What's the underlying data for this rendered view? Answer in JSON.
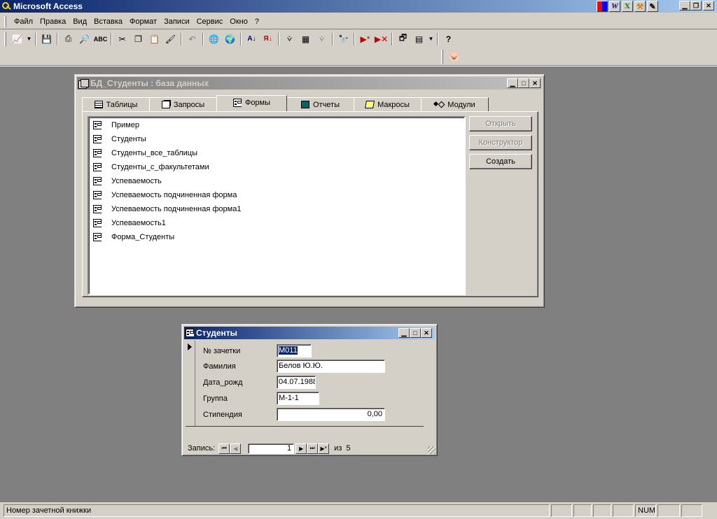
{
  "app": {
    "title": "Microsoft Access"
  },
  "office_icons": [
    "W",
    "X",
    "",
    ""
  ],
  "menu": [
    "Файл",
    "Правка",
    "Вид",
    "Вставка",
    "Формат",
    "Записи",
    "Сервис",
    "Окно",
    "?"
  ],
  "db_window": {
    "title": "БД_Студенты : база данных",
    "tabs": [
      "Таблицы",
      "Запросы",
      "Формы",
      "Отчеты",
      "Макросы",
      "Модули"
    ],
    "selected_tab": "Формы",
    "items": [
      "Пример",
      "Студенты",
      "Студенты_все_таблицы",
      "Студенты_с_факультетами",
      "Успеваемость",
      "Успеваемость подчиненная форма",
      "Успеваемость подчиненная форма1",
      "Успеваемость1",
      "Форма_Студенты"
    ],
    "buttons": {
      "open": "Открыть",
      "design": "Конструктор",
      "create": "Создать"
    }
  },
  "form_window": {
    "title": "Студенты",
    "fields": {
      "record_book_label": "№ зачетки",
      "record_book_value": "М011",
      "surname_label": "Фамилия",
      "surname_value": "Белов Ю.Ю.",
      "birthdate_label": "Дата_рожд",
      "birthdate_value": "04.07.1988",
      "group_label": "Группа",
      "group_value": "М-1-1",
      "stipend_label": "Стипендия",
      "stipend_value": "0,00"
    },
    "nav": {
      "label": "Запись:",
      "current": "1",
      "of_label": "из",
      "total": "5"
    }
  },
  "status": {
    "text": "Номер зачетной книжки",
    "num": "NUM"
  }
}
